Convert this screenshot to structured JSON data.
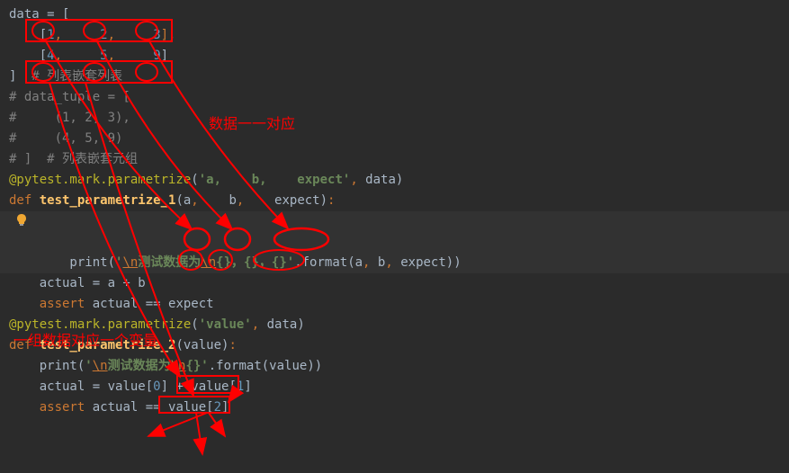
{
  "lines": {
    "l1": "data = [",
    "l2_pre": "    [",
    "l2_n1": "1",
    "l2_n2": "2",
    "l2_n3": "3",
    "l2_suf": "],",
    "l3": "",
    "l4_pre": "    [",
    "l4_n1": "4",
    "l4_n2": "5",
    "l4_n3": "9",
    "l4_suf": "]",
    "l5_close": "]  ",
    "l5_comment": "# 列表嵌套列表",
    "l6": "# data_tuple = [",
    "l7": "#     (1, 2, 3),",
    "l8": "#     (4, 5, 9)",
    "l9": "# ]  # 列表嵌套元组",
    "l10": "",
    "l11": "",
    "l12_dec": "@pytest.mark.parametrize",
    "l12_open": "(",
    "l12_str": "'a,    b,    expect'",
    "l12_rest": ", data)",
    "l13_def": "def ",
    "l13_name": "test_parametrize_1",
    "l13_params": "(a,    b,    expect)",
    "l13_colon": ":",
    "l14_indent": "    print(",
    "l14_str_pre": "'",
    "l14_esc1": "\\n",
    "l14_str_mid1": "测试数据为",
    "l14_esc2": "\\n",
    "l14_str_mid2": "{}，{}，{}'",
    "l14_fmt": ".format(a",
    "l14_c1": ", ",
    "l14_b": "b",
    "l14_c2": ", ",
    "l14_e": "expect))",
    "l15": "    actual = a + b",
    "l16_indent": "    ",
    "l16_assert": "assert ",
    "l16_rest": "actual == expect",
    "l17": "",
    "l18": "",
    "l19_dec": "@pytest.mark.parametrize",
    "l19_open": "(",
    "l19_str": "'value'",
    "l19_rest": ", data)",
    "l20_def": "def ",
    "l20_name": "test_parametrize_2",
    "l20_params": "(value)",
    "l20_colon": ":",
    "l21_indent": "    print(",
    "l21_str_pre": "'",
    "l21_esc1": "\\n",
    "l21_str_mid1": "测试数据为",
    "l21_esc2": "\\n",
    "l21_str_mid2": "{}'",
    "l21_fmt": ".format(value))",
    "l22_pre": "    actual = value[",
    "l22_n0": "0",
    "l22_mid": "] + value[",
    "l22_n1": "1",
    "l22_suf": "]",
    "l23_indent": "    ",
    "l23_assert": "assert ",
    "l23_pre": "actual == value[",
    "l23_n2": "2",
    "l23_suf": "]"
  },
  "annotations": {
    "data_correspond": "数据一一对应",
    "group_correspond": "一组数据对应一个变量"
  },
  "colors": {
    "bg": "#2b2b2b",
    "highlight_bg": "#323232",
    "keyword": "#cc7832",
    "decorator": "#bbb529",
    "func": "#ffc66d",
    "string": "#6a8759",
    "comment": "#808080",
    "number": "#6897bb",
    "default": "#a9b7c6",
    "annotation": "#ff0000"
  }
}
